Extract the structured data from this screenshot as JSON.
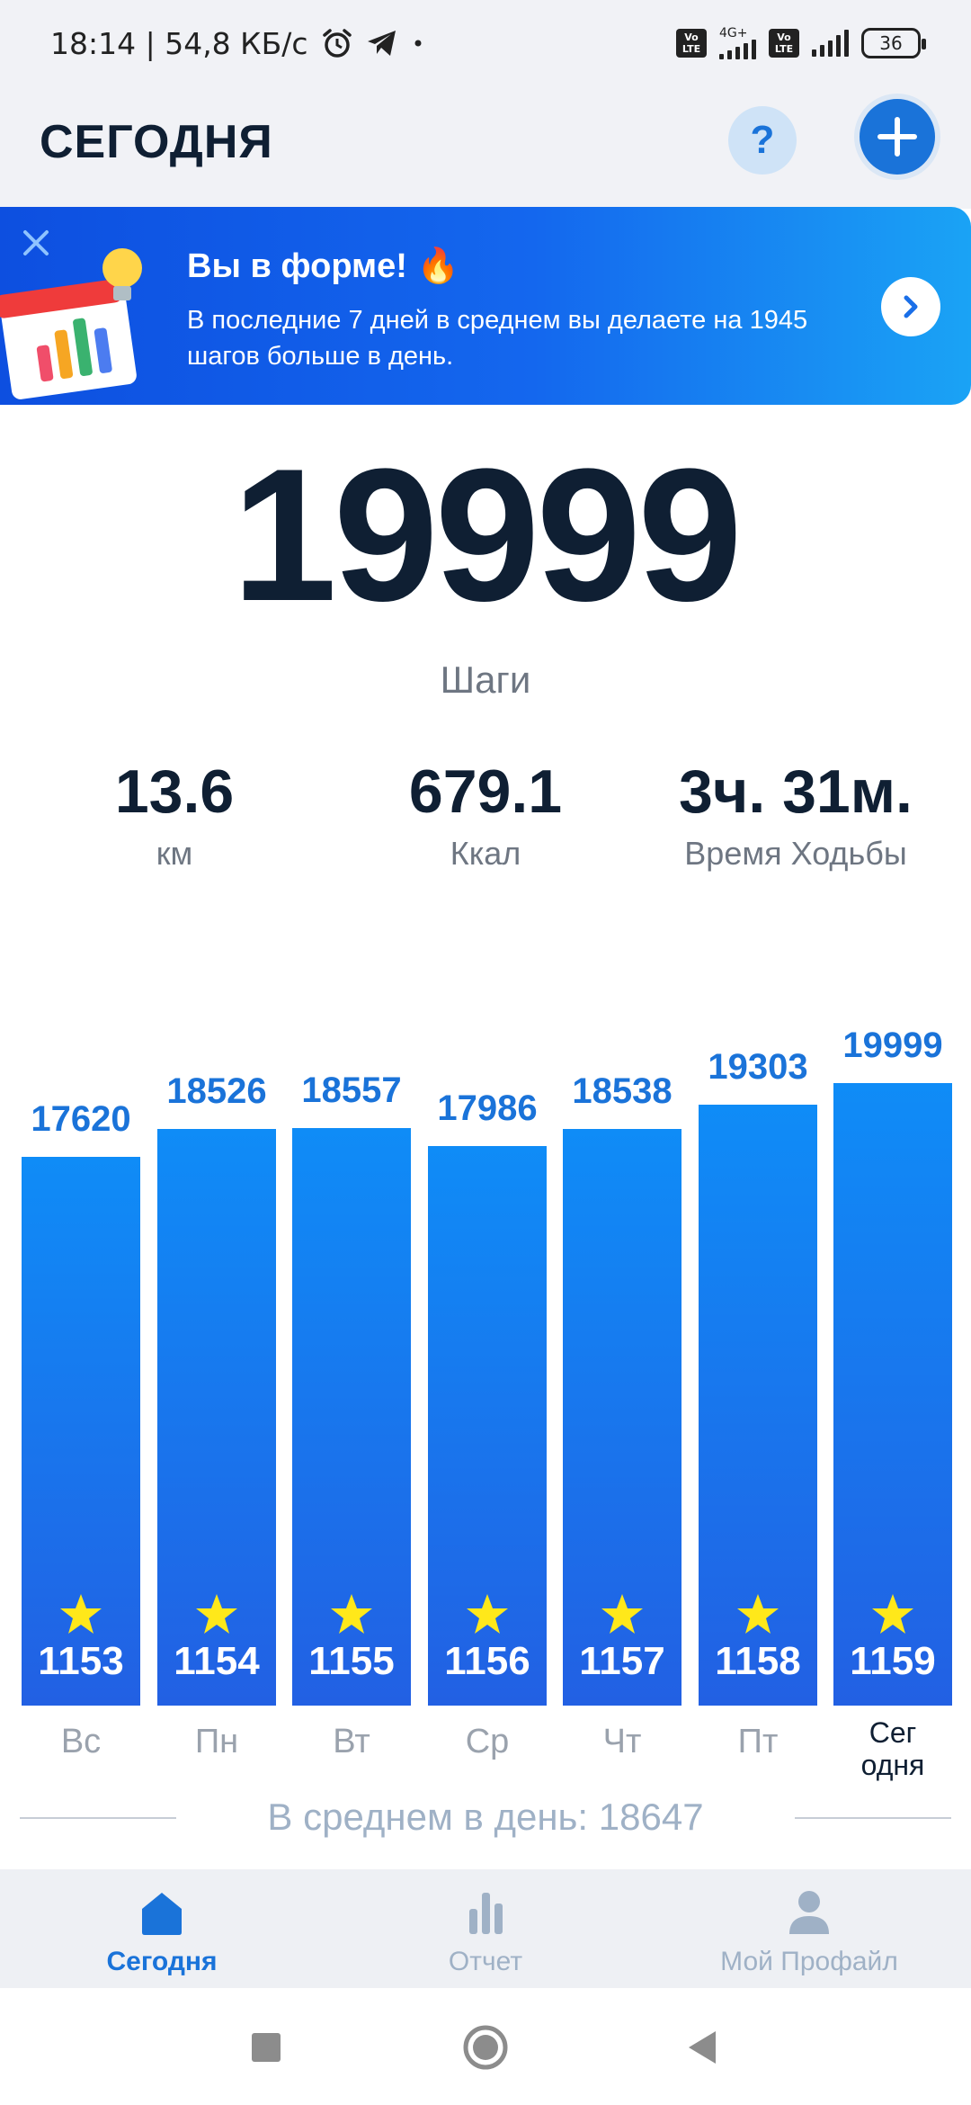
{
  "status_bar": {
    "time_speed": "18:14 | 54,8 КБ/с",
    "volte1": "Vo LTE",
    "net_type": "4G+",
    "volte2": "Vo LTE",
    "battery": "36"
  },
  "header": {
    "title": "СЕГОДНЯ",
    "help_label": "?"
  },
  "banner": {
    "title": "Вы в форме! 🔥",
    "text": "В последние 7 дней в среднем вы делаете на 1945 шагов больше в день."
  },
  "summary": {
    "steps": "19999",
    "steps_label": "Шаги",
    "distance_value": "13.6",
    "distance_unit": "км",
    "calories_value": "679.1",
    "calories_unit": "Ккал",
    "time_value": "3ч. 31м.",
    "time_label": "Время Ходьбы"
  },
  "chart_data": {
    "type": "bar",
    "categories": [
      "Вс",
      "Пн",
      "Вт",
      "Ср",
      "Чт",
      "Пт",
      "Сег одня"
    ],
    "values": [
      17620,
      18526,
      18557,
      17986,
      18538,
      19303,
      19999
    ],
    "bar_bottom_labels": [
      "1153",
      "1154",
      "1155",
      "1156",
      "1157",
      "1158",
      "1159"
    ],
    "ylim": [
      0,
      19999
    ],
    "highlight_index": 6
  },
  "chart_labels": {
    "values": [
      "17620",
      "18526",
      "18557",
      "17986",
      "18538",
      "19303",
      "19999"
    ],
    "days": [
      "Вс",
      "Пн",
      "Вт",
      "Ср",
      "Чт",
      "Пт"
    ],
    "today_line1": "Сег",
    "today_line2": "одня"
  },
  "average": {
    "text": "В среднем в день: 18647"
  },
  "bottom_nav": {
    "today": "Сегодня",
    "report": "Отчет",
    "profile": "Мой Профайл"
  },
  "colors": {
    "accent": "#1a73d9",
    "bar_top": "#0f8cf7",
    "bar_bottom": "#2260e3",
    "star": "#ffe81a"
  }
}
